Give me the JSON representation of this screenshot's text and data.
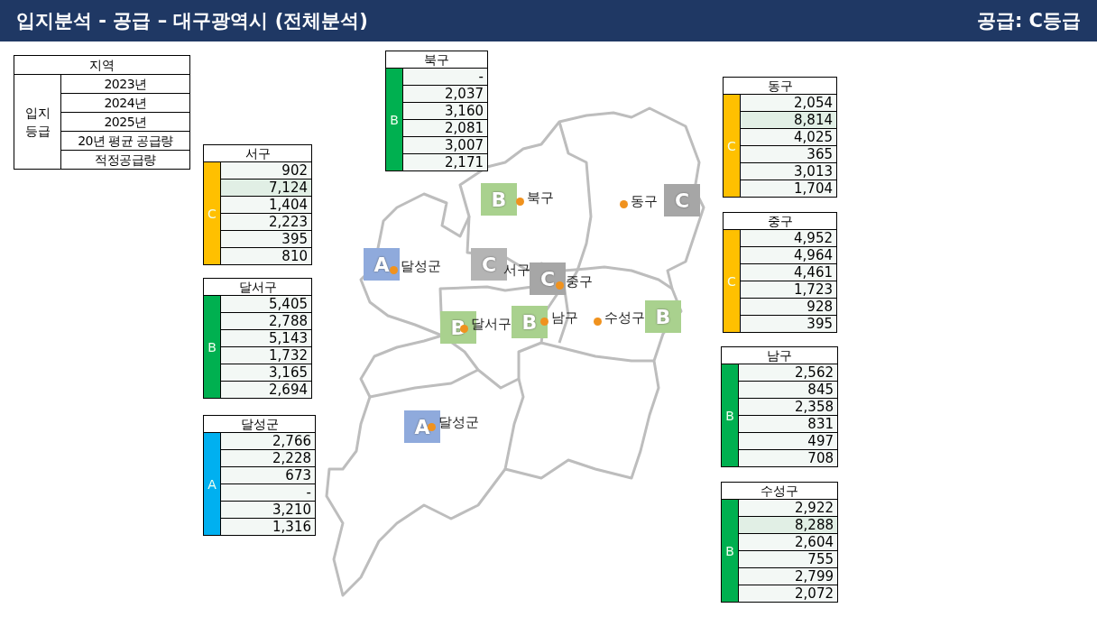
{
  "header": {
    "title": "입지분석 - 공급 – 대구광역시 (전체분석)",
    "grade_label": "공급: C등급"
  },
  "legend": {
    "header": "지역",
    "group_label": "입지 등급",
    "rows": [
      "2023년",
      "2024년",
      "2025년",
      "20년 평균 공급량",
      "적정공급량"
    ]
  },
  "district_tables": [
    {
      "name": "서구",
      "grade": "C",
      "color": "#ffc000",
      "rows": [
        {
          "value": "902",
          "highlighted": false
        },
        {
          "value": "7,124",
          "highlighted": true
        },
        {
          "value": "1,404",
          "highlighted": false
        },
        {
          "value": "2,223",
          "highlighted": false
        },
        {
          "value": "395",
          "highlighted": false
        },
        {
          "value": "810",
          "highlighted": false
        }
      ]
    },
    {
      "name": "달서구",
      "grade": "B",
      "color": "#00b050",
      "rows": [
        {
          "value": "5,405",
          "highlighted": false
        },
        {
          "value": "2,788",
          "highlighted": false
        },
        {
          "value": "5,143",
          "highlighted": false
        },
        {
          "value": "1,732",
          "highlighted": false
        },
        {
          "value": "3,165",
          "highlighted": false
        },
        {
          "value": "2,694",
          "highlighted": false
        }
      ]
    },
    {
      "name": "달성군",
      "grade": "A",
      "color": "#00b0f0",
      "rows": [
        {
          "value": "2,766",
          "highlighted": false
        },
        {
          "value": "2,228",
          "highlighted": false
        },
        {
          "value": "673",
          "highlighted": false
        },
        {
          "value": "-",
          "highlighted": false
        },
        {
          "value": "3,210",
          "highlighted": false
        },
        {
          "value": "1,316",
          "highlighted": false
        }
      ]
    },
    {
      "name": "북구",
      "grade": "B",
      "color": "#00b050",
      "rows": [
        {
          "value": "-",
          "highlighted": false
        },
        {
          "value": "2,037",
          "highlighted": false
        },
        {
          "value": "3,160",
          "highlighted": false
        },
        {
          "value": "2,081",
          "highlighted": false
        },
        {
          "value": "3,007",
          "highlighted": false
        },
        {
          "value": "2,171",
          "highlighted": false
        }
      ]
    },
    {
      "name": "동구",
      "grade": "C",
      "color": "#ffc000",
      "rows": [
        {
          "value": "2,054",
          "highlighted": false
        },
        {
          "value": "8,814",
          "highlighted": true
        },
        {
          "value": "4,025",
          "highlighted": false
        },
        {
          "value": "365",
          "highlighted": false
        },
        {
          "value": "3,013",
          "highlighted": false
        },
        {
          "value": "1,704",
          "highlighted": false
        }
      ]
    },
    {
      "name": "중구",
      "grade": "C",
      "color": "#ffc000",
      "rows": [
        {
          "value": "4,952",
          "highlighted": false
        },
        {
          "value": "4,964",
          "highlighted": false
        },
        {
          "value": "4,461",
          "highlighted": false
        },
        {
          "value": "1,723",
          "highlighted": false
        },
        {
          "value": "928",
          "highlighted": false
        },
        {
          "value": "395",
          "highlighted": false
        }
      ]
    },
    {
      "name": "남구",
      "grade": "B",
      "color": "#00b050",
      "rows": [
        {
          "value": "2,562",
          "highlighted": false
        },
        {
          "value": "845",
          "highlighted": false
        },
        {
          "value": "2,358",
          "highlighted": false
        },
        {
          "value": "831",
          "highlighted": false
        },
        {
          "value": "497",
          "highlighted": false
        },
        {
          "value": "708",
          "highlighted": false
        }
      ]
    },
    {
      "name": "수성구",
      "grade": "B",
      "color": "#00b050",
      "rows": [
        {
          "value": "2,922",
          "highlighted": false
        },
        {
          "value": "8,288",
          "highlighted": true
        },
        {
          "value": "2,604",
          "highlighted": false
        },
        {
          "value": "755",
          "highlighted": false
        },
        {
          "value": "2,799",
          "highlighted": false
        },
        {
          "value": "2,072",
          "highlighted": false
        }
      ]
    }
  ],
  "map_markers": [
    {
      "grade": "B",
      "color": "#a9d18e",
      "label": "북구",
      "dot": true
    },
    {
      "grade": "C",
      "color": "#a6a6a6",
      "label": "동구",
      "dot": true
    },
    {
      "grade": "A",
      "color": "#8faadc",
      "label": "달성군",
      "dot": true
    },
    {
      "grade": "C",
      "color": "#b4b4b4",
      "label": "서구",
      "dot": false
    },
    {
      "grade": "C",
      "color": "#a6a6a6",
      "label": "중구",
      "dot": true
    },
    {
      "grade": "B",
      "color": "#a9d18e",
      "label": "달서구",
      "dot": true
    },
    {
      "grade": "B",
      "color": "#a9d18e",
      "label": "남구",
      "dot": true
    },
    {
      "grade": "B",
      "color": "#a9d18e",
      "label": "수성구",
      "dot": true
    },
    {
      "grade": "A",
      "color": "#8faadc",
      "label": "달성군",
      "dot": true
    }
  ]
}
